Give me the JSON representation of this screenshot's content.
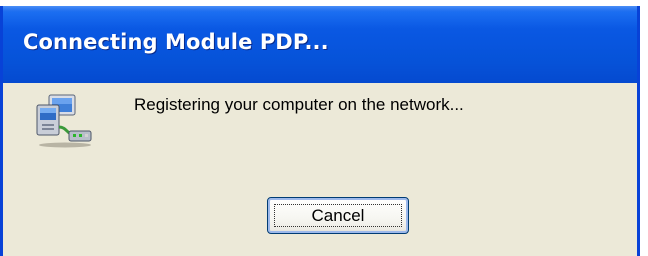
{
  "window": {
    "title": "Connecting Module PDP..."
  },
  "dialog": {
    "icon": "network-computer-icon",
    "message": "Registering your computer on the network...",
    "cancel_label": "Cancel"
  },
  "colors": {
    "titlebar": "#0653d9",
    "client_background": "#ece9d8",
    "button_border": "#003c74"
  }
}
